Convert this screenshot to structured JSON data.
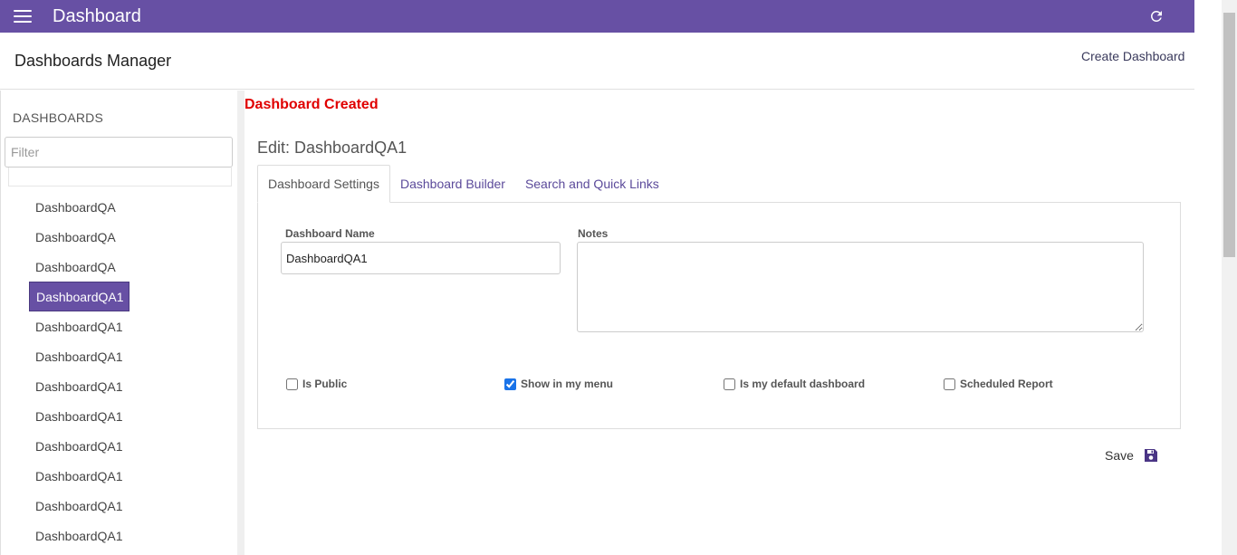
{
  "topbar": {
    "title": "Dashboard",
    "menu_icon": "hamburger-menu-icon",
    "refresh_icon": "refresh-icon",
    "color": "#6750a4"
  },
  "header": {
    "title": "Dashboards Manager",
    "create_label": "Create Dashboard"
  },
  "sidebar": {
    "heading": "DASHBOARDS",
    "filter_placeholder": "Filter",
    "items": [
      {
        "label": "DashboardQA",
        "active": false
      },
      {
        "label": "DashboardQA",
        "active": false
      },
      {
        "label": "DashboardQA",
        "active": false
      },
      {
        "label": "DashboardQA1",
        "active": true
      },
      {
        "label": "DashboardQA1",
        "active": false
      },
      {
        "label": "DashboardQA1",
        "active": false
      },
      {
        "label": "DashboardQA1",
        "active": false
      },
      {
        "label": "DashboardQA1",
        "active": false
      },
      {
        "label": "DashboardQA1",
        "active": false
      },
      {
        "label": "DashboardQA1",
        "active": false
      },
      {
        "label": "DashboardQA1",
        "active": false
      },
      {
        "label": "DashboardQA1",
        "active": false
      }
    ]
  },
  "main": {
    "status": "Dashboard Created",
    "edit_title": "Edit: DashboardQA1",
    "tabs": [
      {
        "label": "Dashboard Settings",
        "active": true
      },
      {
        "label": "Dashboard Builder",
        "active": false
      },
      {
        "label": "Search and Quick Links",
        "active": false
      }
    ],
    "form": {
      "name_label": "Dashboard Name",
      "name_value": "DashboardQA1",
      "notes_label": "Notes",
      "notes_value": "",
      "checkboxes": [
        {
          "label": "Is Public",
          "checked": false
        },
        {
          "label": "Show in my menu",
          "checked": true
        },
        {
          "label": "Is my default dashboard",
          "checked": false
        },
        {
          "label": "Scheduled Report",
          "checked": false
        }
      ]
    },
    "save_label": "Save",
    "save_icon": "floppy-disk-icon"
  }
}
